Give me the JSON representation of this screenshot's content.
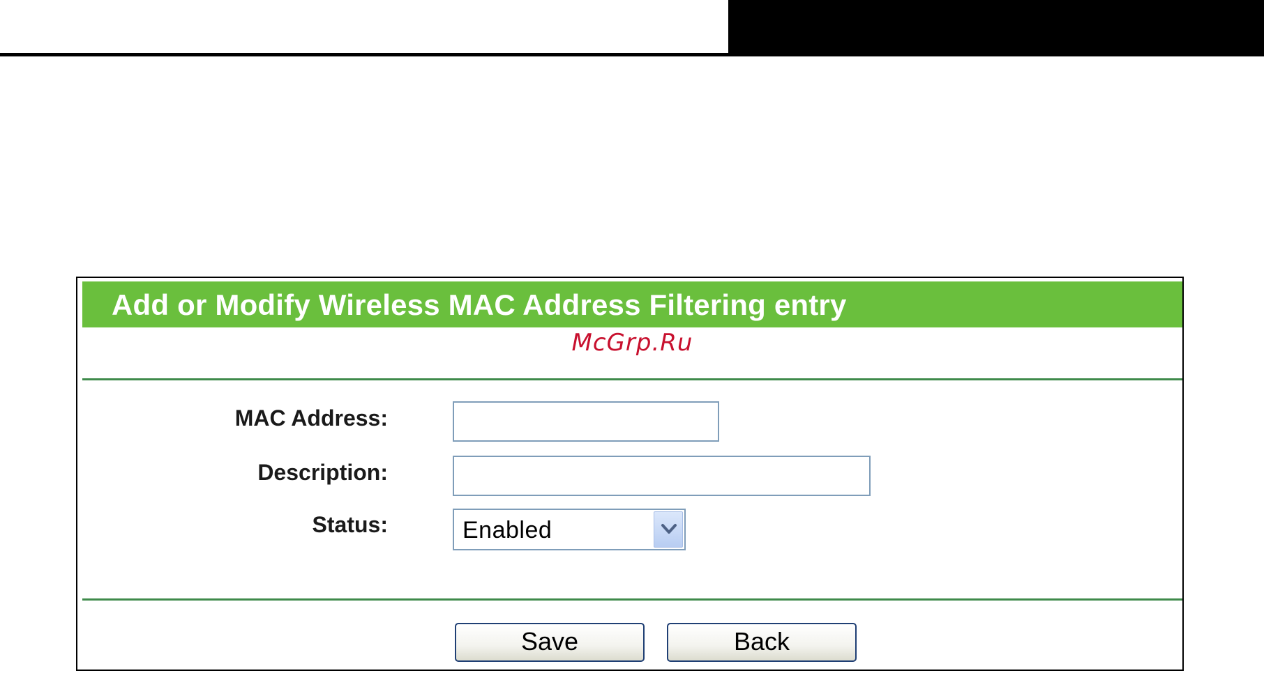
{
  "dialog": {
    "title": "Add or Modify Wireless MAC Address Filtering entry",
    "watermark": "McGrp.Ru"
  },
  "form": {
    "mac_label": "MAC Address:",
    "mac_value": "",
    "description_label": "Description:",
    "description_value": "",
    "status_label": "Status:",
    "status_selected": "Enabled",
    "status_arrow_icon": "chevron-down-icon"
  },
  "buttons": {
    "save_label": "Save",
    "back_label": "Back"
  },
  "colors": {
    "title_bar": "#6abf3d",
    "rule": "#3e8a4a",
    "watermark": "#c8102e"
  }
}
